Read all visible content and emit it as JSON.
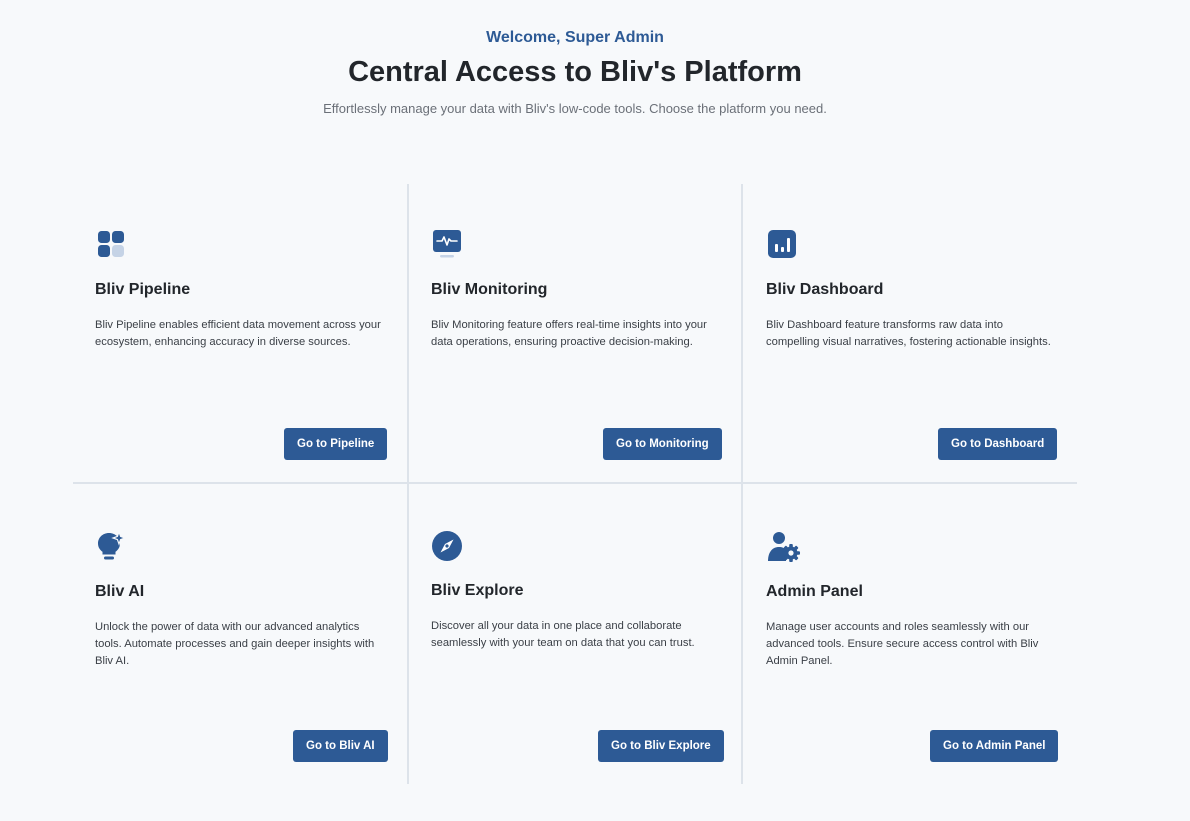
{
  "header": {
    "welcome": "Welcome, Super Admin",
    "title": "Central Access to Bliv's Platform",
    "subtitle": "Effortlessly manage your data with Bliv's low-code tools. Choose the platform you need."
  },
  "theme": {
    "accent": "#2d5a95",
    "accent_light": "#c5d3e6",
    "background": "#f7f9fb",
    "divider": "#dde3ea"
  },
  "cards": [
    {
      "icon": "grid-icon",
      "name": "Bliv Pipeline",
      "description": "Bliv Pipeline enables efficient data movement across your ecosystem, enhancing accuracy in diverse sources.",
      "button": "Go to Pipeline"
    },
    {
      "icon": "monitor-pulse-icon",
      "name": "Bliv Monitoring",
      "description": "Bliv Monitoring feature offers real-time insights into your data operations, ensuring proactive decision-making.",
      "button": "Go to Monitoring"
    },
    {
      "icon": "bar-chart-icon",
      "name": "Bliv Dashboard",
      "description": "Bliv Dashboard feature transforms raw data into compelling visual narratives, fostering actionable insights.",
      "button": "Go to Dashboard"
    },
    {
      "icon": "lightbulb-sparkle-icon",
      "name": "Bliv AI",
      "description": "Unlock the power of data with our advanced analytics tools. Automate processes and gain deeper insights with Bliv AI.",
      "button": "Go to Bliv AI"
    },
    {
      "icon": "compass-icon",
      "name": "Bliv Explore",
      "description": "Discover all your data in one place and collaborate seamlessly with your team on data that you can trust.",
      "button": "Go to Bliv Explore"
    },
    {
      "icon": "user-gear-icon",
      "name": "Admin Panel",
      "description": "Manage user accounts and roles seamlessly with our advanced tools. Ensure secure access control with Bliv Admin Panel.",
      "button": "Go to Admin Panel"
    }
  ]
}
